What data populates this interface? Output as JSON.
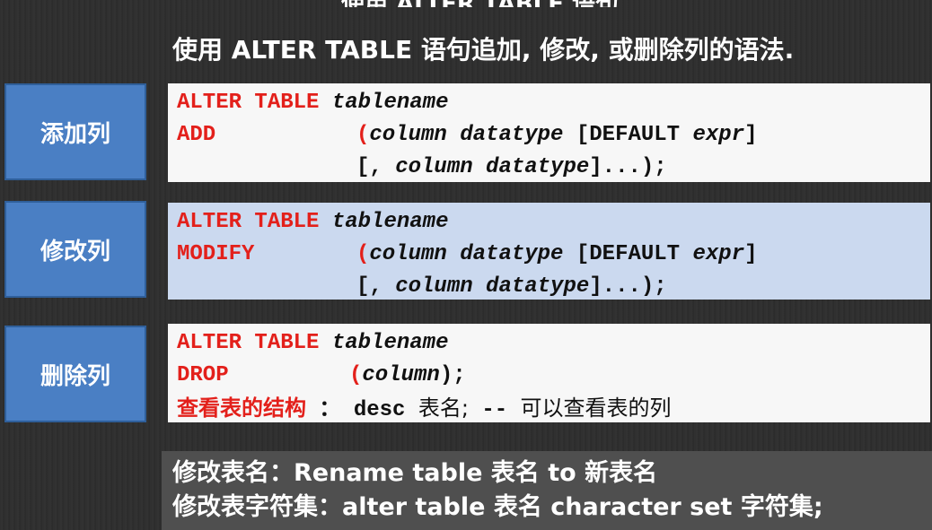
{
  "header_partial": "使用 ALTER TABLE 语句",
  "subtitle": "使用 ALTER TABLE 语句追加, 修改, 或删除列的语法.",
  "sections": [
    {
      "label": "添加列",
      "line1": {
        "kw": "ALTER TABLE",
        "arg": "tablename"
      },
      "line2": {
        "kw": "ADD",
        "paren": "(",
        "col": "column",
        "type": "datatype",
        "default": "[DEFAULT",
        "expr": "expr",
        "close": "]"
      },
      "line3": {
        "open": "[,",
        "col": "column",
        "type": "datatype",
        "tail": "]...);"
      }
    },
    {
      "label": "修改列",
      "line1": {
        "kw": "ALTER TABLE",
        "arg": "tablename"
      },
      "line2": {
        "kw": "MODIFY",
        "paren": "(",
        "col": "column",
        "type": "datatype",
        "default": "[DEFAULT",
        "expr": "expr",
        "close": "]"
      },
      "line3": {
        "open": "[,",
        "col": "column",
        "type": "datatype",
        "tail": "]...);"
      }
    },
    {
      "label": "删除列",
      "line1": {
        "kw": "ALTER TABLE",
        "arg": "tablename"
      },
      "line2": {
        "kw": "DROP",
        "paren": "(",
        "col": "column",
        "close": ");"
      },
      "line3": {
        "note": "查看表的结构",
        "sep": "：",
        "cmd": "desc",
        "rest": "表名;",
        "comment": "--",
        "comment_text": "可以查看表的列"
      }
    }
  ],
  "bottom": {
    "line1": "修改表名：Rename table 表名 to 新表名",
    "line2": "修改表字符集：alter table 表名 character set 字符集;"
  }
}
